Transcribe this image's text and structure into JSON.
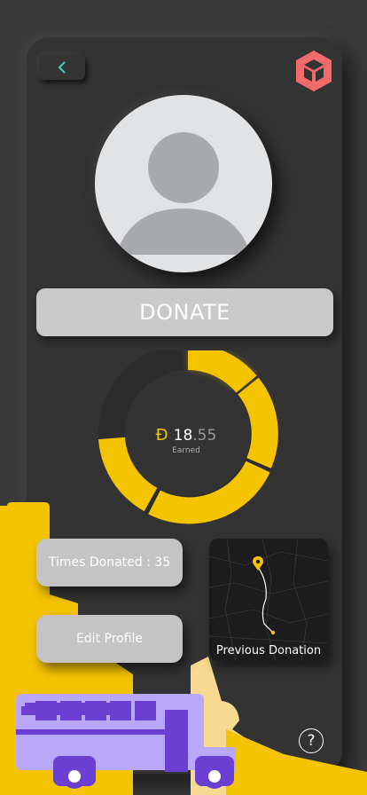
{
  "header": {
    "back_icon": "chevron-left-icon",
    "logo_icon": "box-logo-icon"
  },
  "avatar": {
    "icon": "user-silhouette-icon"
  },
  "donate_button": {
    "label": "DONATE"
  },
  "earnings": {
    "currency_symbol": "Ð",
    "amount_integer": "18",
    "amount_decimal": ".55",
    "label": "Earned",
    "segments": [
      0.2,
      0.25,
      0.3,
      0.25
    ]
  },
  "stats": {
    "times_donated_label": "Times Donated : 35"
  },
  "actions": {
    "edit_profile_label": "Edit Profile"
  },
  "previous_donation": {
    "label": "Previous Donation",
    "pin_icon": "map-pin-icon"
  },
  "help": {
    "label": "?"
  },
  "colors": {
    "accent": "#f5c400",
    "logo": "#f26b6b",
    "back_chevron": "#3fd0c4",
    "bus": "#b8a8f7",
    "hand": "#f5c400"
  }
}
